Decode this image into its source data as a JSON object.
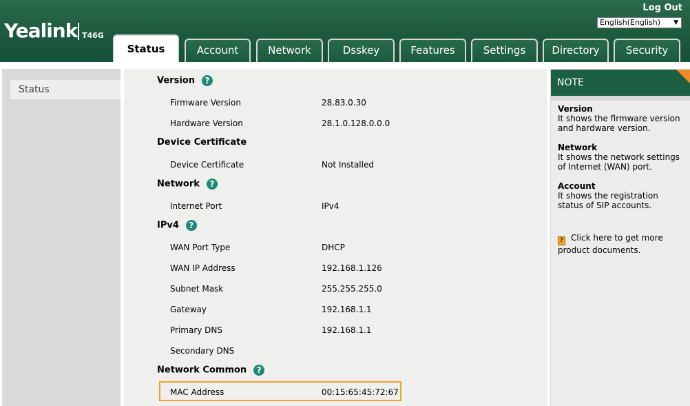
{
  "header": {
    "brand": "Yealink",
    "model": "T46G",
    "logout": "Log Out",
    "language": "English(English)"
  },
  "tabs": [
    "Status",
    "Account",
    "Network",
    "Dsskey",
    "Features",
    "Settings",
    "Directory",
    "Security"
  ],
  "sidebar": {
    "items": [
      "Status"
    ]
  },
  "main": {
    "version": {
      "title": "Version",
      "firmware_label": "Firmware Version",
      "firmware_value": "28.83.0.30",
      "hardware_label": "Hardware Version",
      "hardware_value": "28.1.0.128.0.0.0"
    },
    "cert": {
      "title": "Device Certificate",
      "label": "Device Certificate",
      "value": "Not Installed"
    },
    "network": {
      "title": "Network",
      "port_label": "Internet Port",
      "port_value": "IPv4"
    },
    "ipv4": {
      "title": "IPv4",
      "wan_type_label": "WAN Port Type",
      "wan_type_value": "DHCP",
      "wan_ip_label": "WAN IP Address",
      "wan_ip_value": "192.168.1.126",
      "subnet_label": "Subnet Mask",
      "subnet_value": "255.255.255.0",
      "gateway_label": "Gateway",
      "gateway_value": "192.168.1.1",
      "pdns_label": "Primary DNS",
      "pdns_value": "192.168.1.1",
      "sdns_label": "Secondary DNS",
      "sdns_value": ""
    },
    "common": {
      "title": "Network Common",
      "mac_label": "MAC Address",
      "mac_value": "00:15:65:45:72:67"
    }
  },
  "note": {
    "title": "NOTE",
    "version_title": "Version",
    "version_text": "It shows the firmware version and hardware version.",
    "network_title": "Network",
    "network_text": "It shows the network settings of Internet (WAN) port.",
    "account_title": "Account",
    "account_text": "It shows the registration status of SIP accounts.",
    "docs_link": "Click here to get more product documents."
  },
  "colors": {
    "header_green": "#1d5a3e",
    "help_teal": "#1e8a73",
    "highlight_orange": "#f0a030"
  }
}
